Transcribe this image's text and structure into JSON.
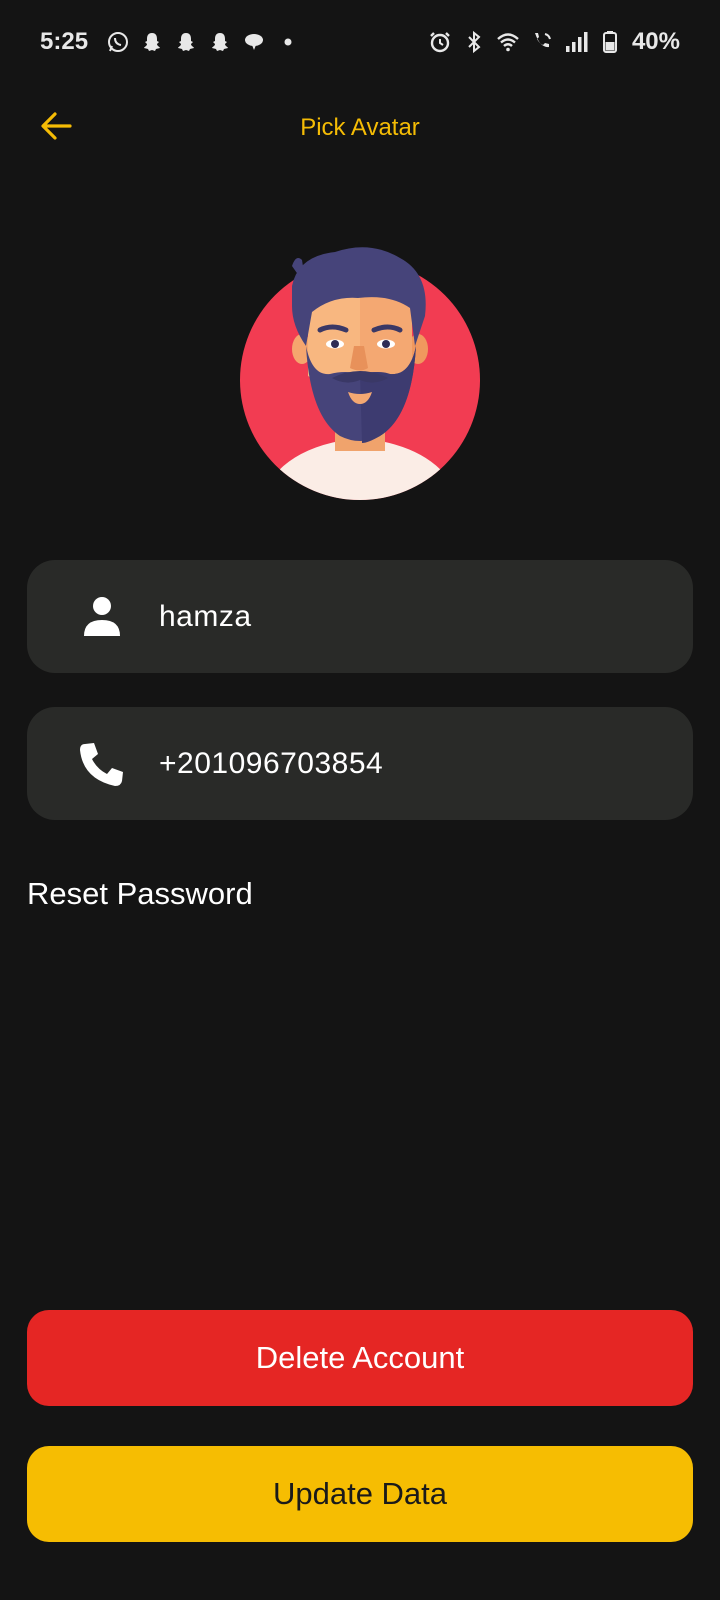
{
  "status_bar": {
    "time": "5:25",
    "battery": "40%",
    "icons_left": [
      "whatsapp-icon",
      "snapchat-icon",
      "snapchat-icon",
      "snapchat-icon",
      "chat-bubble-icon",
      "dot-icon"
    ],
    "icons_right": [
      "alarm-icon",
      "bluetooth-icon",
      "wifi-icon",
      "wifi-call-icon",
      "signal-icon",
      "battery-icon"
    ]
  },
  "header": {
    "title": "Pick Avatar",
    "back_icon": "arrow-left-icon"
  },
  "avatar": {
    "icon": "bearded-man-avatar",
    "background_color": "#f23c52"
  },
  "fields": {
    "name": {
      "icon": "person-icon",
      "value": "hamza"
    },
    "phone": {
      "icon": "phone-icon",
      "value": "+201096703854"
    }
  },
  "links": {
    "reset_password": "Reset Password"
  },
  "buttons": {
    "delete_label": "Delete Account",
    "update_label": "Update Data"
  },
  "colors": {
    "accent": "#F5BC05",
    "background": "#141414",
    "field_background": "#292a28",
    "delete": "#e52624",
    "update": "#f6bd02"
  }
}
